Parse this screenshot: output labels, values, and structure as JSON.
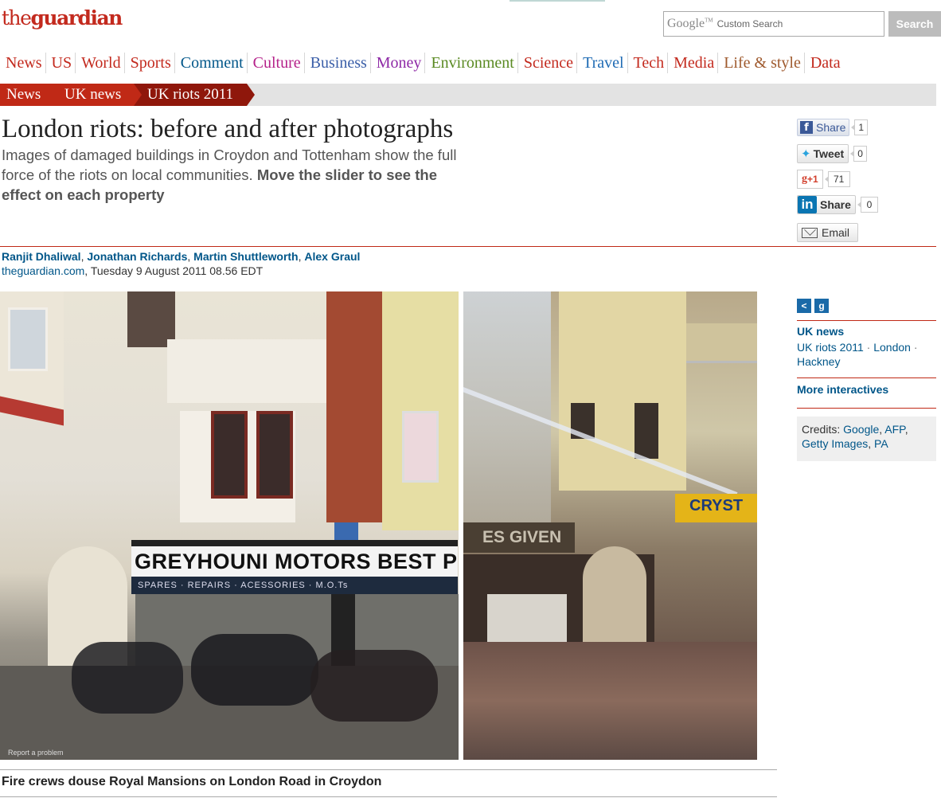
{
  "header": {
    "logo_the": "the",
    "logo_name": "guardian",
    "search_placeholder_brand": "Google",
    "search_placeholder_tm": "TM",
    "search_placeholder_text": "Custom Search",
    "search_button": "Search"
  },
  "nav": [
    {
      "label": "News",
      "color": "#c32a1e"
    },
    {
      "label": "US",
      "color": "#c32a1e"
    },
    {
      "label": "World",
      "color": "#c32a1e"
    },
    {
      "label": "Sports",
      "color": "#c32a1e"
    },
    {
      "label": "Comment",
      "color": "#005689"
    },
    {
      "label": "Culture",
      "color": "#b5218a"
    },
    {
      "label": "Business",
      "color": "#3a5ea8"
    },
    {
      "label": "Money",
      "color": "#8e29a6"
    },
    {
      "label": "Environment",
      "color": "#5a8a22"
    },
    {
      "label": "Science",
      "color": "#c32a1e"
    },
    {
      "label": "Travel",
      "color": "#1f6bb4"
    },
    {
      "label": "Tech",
      "color": "#c32a1e"
    },
    {
      "label": "Media",
      "color": "#c32a1e"
    },
    {
      "label": "Life & style",
      "color": "#9f5a2e"
    },
    {
      "label": "Data",
      "color": "#c32a1e"
    }
  ],
  "breadcrumb": [
    "News",
    "UK news",
    "UK riots 2011"
  ],
  "article": {
    "headline": "London riots: before and after photographs",
    "standfirst_plain": "Images of damaged buildings in Croydon and Tottenham show the full force of the riots on local communities. ",
    "standfirst_bold": "Move the slider to see the effect on each property",
    "authors": [
      "Ranjit Dhaliwal",
      "Jonathan Richards",
      "Martin Shuttleworth",
      "Alex Graul"
    ],
    "source": "theguardian.com",
    "date": ", Tuesday 9 August 2011 08.56 EDT",
    "caption": "Fire crews douse Royal Mansions on London Road in Croydon"
  },
  "share": {
    "facebook_label": "Share",
    "facebook_count": "1",
    "twitter_label": "Tweet",
    "twitter_count": "0",
    "gplus_label": "+1",
    "gplus_count": "71",
    "linkedin_label": "Share",
    "linkedin_count": "0",
    "email_label": "Email"
  },
  "photo": {
    "before_sign": "GREYHOUNI MOTORS   BEST PRI",
    "before_band": "SPARES · REPAIRS · ACESSORIES · M.O.Ts",
    "report": "Report a problem",
    "after_sign": "ES GIVEN",
    "after_shop": "CRYST"
  },
  "sidebar": {
    "section_title": "UK news",
    "links": [
      "UK riots 2011",
      "London",
      "Hackney"
    ],
    "more": "More interactives",
    "credits_label": "Credits: ",
    "credits": [
      "Google",
      "AFP",
      "Getty Images",
      "PA"
    ]
  }
}
